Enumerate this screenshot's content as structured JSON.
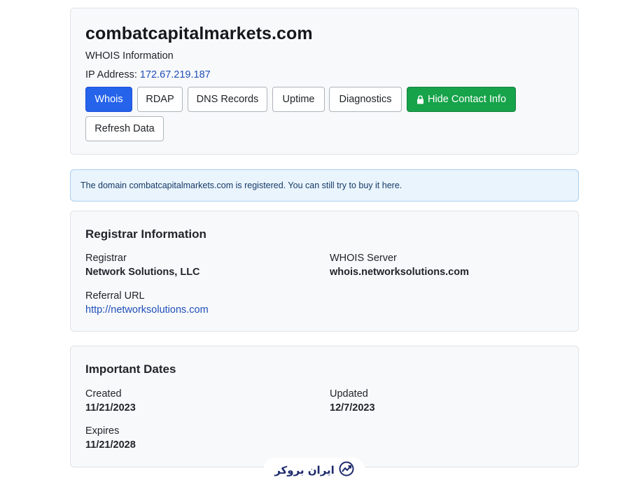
{
  "header": {
    "domain": "combatcapitalmarkets.com",
    "subtitle": "WHOIS Information",
    "ip_label": "IP Address:",
    "ip_value": "172.67.219.187"
  },
  "buttons": {
    "whois": "Whois",
    "rdap": "RDAP",
    "dns": "DNS Records",
    "uptime": "Uptime",
    "diagnostics": "Diagnostics",
    "hide_contact": "Hide Contact Info",
    "refresh": "Refresh Data"
  },
  "alert": {
    "text": "The domain combatcapitalmarkets.com is registered. You can still try to buy it here."
  },
  "registrar": {
    "title": "Registrar Information",
    "registrar_label": "Registrar",
    "registrar_value": "Network Solutions, LLC",
    "server_label": "WHOIS Server",
    "server_value": "whois.networksolutions.com",
    "referral_label": "Referral URL",
    "referral_value": "http://networksolutions.com"
  },
  "dates": {
    "title": "Important Dates",
    "created_label": "Created",
    "created_value": "11/21/2023",
    "updated_label": "Updated",
    "updated_value": "12/7/2023",
    "expires_label": "Expires",
    "expires_value": "11/21/2028"
  },
  "watermark": {
    "text": "ایران بروکر",
    "icon": "chart-growth-icon"
  },
  "colors": {
    "primary": "#2563eb",
    "success": "#16a34a",
    "link": "#1f4fb8",
    "alert_bg": "#eaf4fd",
    "alert_border": "#a9cff3"
  }
}
